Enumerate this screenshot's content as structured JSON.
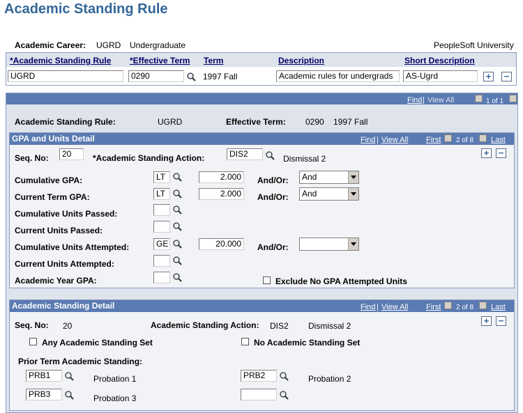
{
  "page_title": "Academic Standing Rule",
  "header": {
    "career_label": "Academic Career:",
    "career_code": "UGRD",
    "career_desc": "Undergraduate",
    "institution": "PeopleSoft University"
  },
  "grid": {
    "columns": [
      "*Academic Standing Rule",
      "*Effective Term",
      "Term",
      "Description",
      "Short Description"
    ],
    "row": {
      "rule": "UGRD",
      "effective_term": "0290",
      "term": "1997 Fall",
      "description": "Academic rules for undergrads",
      "short_description": "AS-Ugrd"
    }
  },
  "top_nav": {
    "find": "Find",
    "view_all": "View All",
    "count": "1 of 1"
  },
  "summary": {
    "rule_label": "Academic Standing Rule:",
    "rule_value": "UGRD",
    "term_label": "Effective Term:",
    "term_code": "0290",
    "term_desc": "1997 Fall"
  },
  "gpa_section": {
    "title": "GPA and Units Detail",
    "nav": {
      "find": "Find",
      "view_all": "View All",
      "first": "First",
      "count": "2 of 8",
      "last": "Last"
    },
    "seq_label": "Seq. No:",
    "seq_value": "20",
    "action_label": "*Academic Standing Action:",
    "action_value": "DIS2",
    "action_desc": "Dismissal 2",
    "rows": [
      {
        "label": "Cumulative GPA:",
        "op": "LT",
        "value": "2.000",
        "andor_label": "And/Or:",
        "andor": "And"
      },
      {
        "label": "Current Term GPA:",
        "op": "LT",
        "value": "2.000",
        "andor_label": "And/Or:",
        "andor": "And"
      },
      {
        "label": "Cumulative Units Passed:",
        "op": ""
      },
      {
        "label": "Current Units Passed:",
        "op": ""
      },
      {
        "label": "Cumulative Units Attempted:",
        "op": "GE",
        "value": "20.000",
        "andor_label": "And/Or:",
        "andor": ""
      },
      {
        "label": "Current Units Attempted:",
        "op": ""
      },
      {
        "label": "Academic Year GPA:",
        "op": ""
      }
    ],
    "exclude_label": "Exclude No GPA Attempted Units"
  },
  "standing_section": {
    "title": "Academic Standing Detail",
    "nav": {
      "find": "Find",
      "view_all": "View All",
      "first": "First",
      "count": "2 of 8",
      "last": "Last"
    },
    "seq_label": "Seq. No:",
    "seq_value": "20",
    "action_label": "Academic Standing Action:",
    "action_value": "DIS2",
    "action_desc": "Dismissal 2",
    "any_label": "Any Academic Standing Set",
    "no_label": "No Academic Standing Set",
    "prior_label": "Prior Term Academic Standing:",
    "prior": [
      {
        "code": "PRB1",
        "desc": "Probation 1"
      },
      {
        "code": "PRB2",
        "desc": "Probation 2"
      },
      {
        "code": "PRB3",
        "desc": "Probation 3"
      },
      {
        "code": "",
        "desc": ""
      }
    ]
  },
  "colors": {
    "title": "#336699",
    "section_header": "#5a7ab2",
    "grid_header": "#dfe3ec",
    "link": "#000066"
  },
  "icons": [
    "lookup-icon",
    "add-row-icon",
    "delete-row-icon",
    "nav-prev-icon",
    "nav-next-icon",
    "dropdown-arrow-icon"
  ]
}
